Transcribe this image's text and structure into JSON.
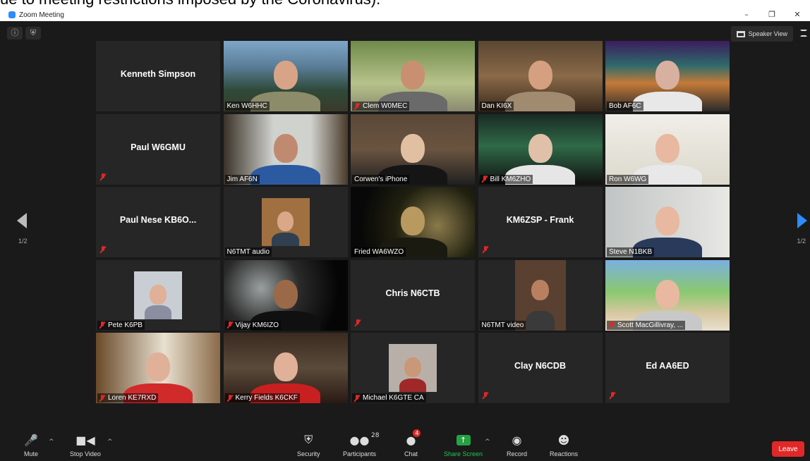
{
  "caption": "ue to meeting restrictions imposed by the Coronavirus).",
  "window": {
    "title": "Zoom Meeting",
    "minimize": "–",
    "restore": "❐",
    "close": "✕"
  },
  "topbar": {
    "speaker_view_label": "Speaker View"
  },
  "pagination": {
    "left": "1/2",
    "right": "1/2"
  },
  "tiles": [
    {
      "name": "Kenneth Simpson",
      "video": false,
      "muted": false
    },
    {
      "name": "Ken W6HHC",
      "video": true,
      "muted": false
    },
    {
      "name": "Clem W0MEC",
      "video": true,
      "muted": true
    },
    {
      "name": "Dan KI6X",
      "video": true,
      "muted": false,
      "active": true
    },
    {
      "name": "Bob AF6C",
      "video": true,
      "muted": false
    },
    {
      "name": "Paul W6GMU",
      "video": false,
      "muted": true
    },
    {
      "name": "Jim  AF6N",
      "video": true,
      "muted": false
    },
    {
      "name": "Corwen's iPhone",
      "video": true,
      "muted": false
    },
    {
      "name": "Bill KM6ZHO",
      "video": true,
      "muted": true
    },
    {
      "name": "Ron W6WG",
      "video": true,
      "muted": false
    },
    {
      "name": "Paul Nese KB6O...",
      "video": false,
      "muted": true
    },
    {
      "name": "N6TMT audio",
      "video": true,
      "muted": false
    },
    {
      "name": "Fried  WA6WZO",
      "video": true,
      "muted": false
    },
    {
      "name": "KM6ZSP - Frank",
      "video": false,
      "muted": true
    },
    {
      "name": "Steve N1BKB",
      "video": true,
      "muted": false
    },
    {
      "name": "Pete K6PB",
      "video": true,
      "muted": true
    },
    {
      "name": "Vijay KM6IZO",
      "video": true,
      "muted": true
    },
    {
      "name": "Chris  N6CTB",
      "video": false,
      "muted": true
    },
    {
      "name": "N6TMT video",
      "video": true,
      "muted": false
    },
    {
      "name": "Scott MacGillivray, ...",
      "video": true,
      "muted": true
    },
    {
      "name": "Loren KE7RXD",
      "video": true,
      "muted": true
    },
    {
      "name": "Kerry Fields K6CKF",
      "video": true,
      "muted": true
    },
    {
      "name": "Michael K6GTE CA",
      "video": true,
      "muted": true
    },
    {
      "name": "Clay N6CDB",
      "video": false,
      "muted": true
    },
    {
      "name": "Ed AA6ED",
      "video": false,
      "muted": true
    }
  ],
  "toolbar": {
    "mute": "Mute",
    "stop_video": "Stop Video",
    "security": "Security",
    "participants": "Participants",
    "participants_count": "28",
    "chat": "Chat",
    "chat_badge": "4",
    "share_screen": "Share Screen",
    "record": "Record",
    "reactions": "Reactions",
    "leave": "Leave"
  },
  "colors": {
    "meeting_bg": "#1a1a1a",
    "tile_bg": "#262626",
    "active_speaker": "#e3e34a",
    "accent_blue": "#2d8cff",
    "share_green": "#25a244",
    "leave_red": "#e02828"
  }
}
